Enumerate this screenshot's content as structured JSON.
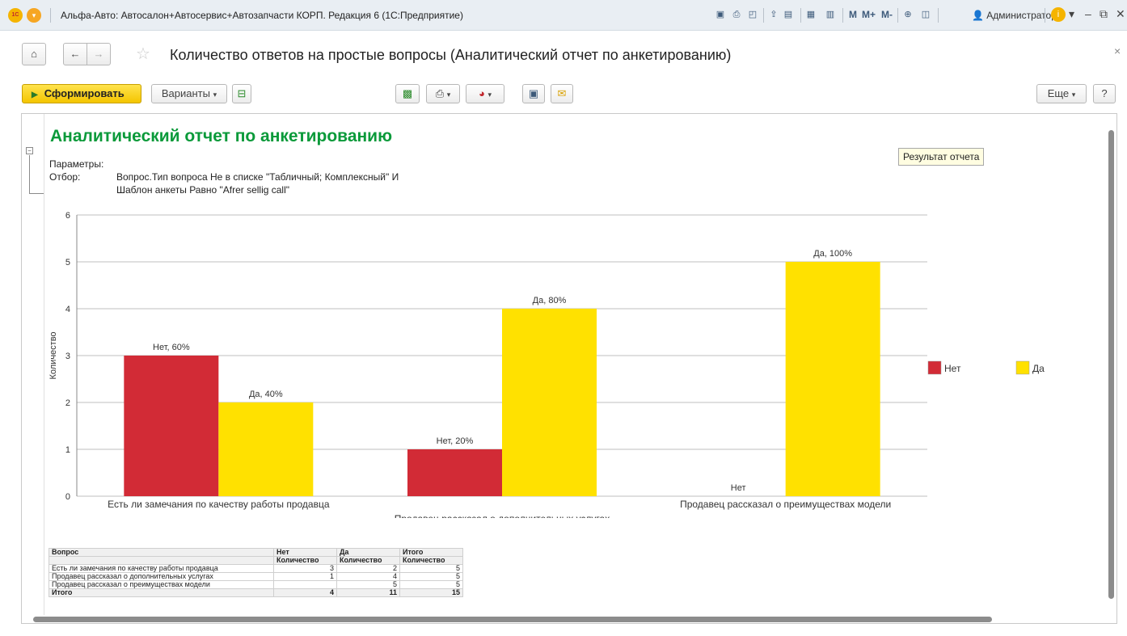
{
  "window": {
    "title": "Альфа-Авто: Автосалон+Автосервис+Автозапчасти КОРП. Редакция 6  (1С:Предприятие)",
    "logo_text": "1С",
    "user": "Администратор",
    "m_buttons": [
      "M",
      "M+",
      "M-"
    ]
  },
  "nav": {
    "page_title": "Количество ответов на простые вопросы (Аналитический отчет по анкетированию)"
  },
  "toolbar": {
    "generate_label": "Сформировать",
    "variants_label": "Варианты",
    "more_label": "Еще",
    "help_label": "?"
  },
  "report": {
    "title": "Аналитический отчет по анкетированию",
    "params_label": "Параметры:",
    "filter_label": "Отбор:",
    "filter_lines": [
      "Вопрос.Тип вопроса Не в списке \"Табличный; Комплексный\" И",
      "Шаблон анкеты Равно \"Afrer sellig call\""
    ],
    "tooltip": "Результат отчета"
  },
  "chart_data": {
    "type": "bar",
    "categories": [
      "Есть ли замечания по качеству работы продавца",
      "Продавец рассказал о дополнительных услугах",
      "Продавец рассказал о преимуществах модели"
    ],
    "series": [
      {
        "name": "Нет",
        "color": "#d22b36",
        "values": [
          3,
          1,
          0
        ],
        "labels": [
          "Нет, 60%",
          "Нет, 20%",
          "Нет"
        ]
      },
      {
        "name": "Да",
        "color": "#ffe100",
        "values": [
          2,
          4,
          5
        ],
        "labels": [
          "Да, 40%",
          "Да, 80%",
          "Да, 100%"
        ]
      }
    ],
    "ylabel": "Количество",
    "xlabel": "",
    "ylim": [
      0,
      6
    ],
    "yticks": [
      "0",
      "1",
      "2",
      "3",
      "4",
      "5",
      "6"
    ],
    "grid": true,
    "legend": "right"
  },
  "table": {
    "header": [
      "Вопрос",
      "Нет",
      "Да",
      "Итого"
    ],
    "subheader": [
      "",
      "Количество",
      "Количество",
      "Количество"
    ],
    "rows": [
      [
        "Есть ли замечания по качеству работы продавца",
        "3",
        "2",
        "5"
      ],
      [
        "Продавец рассказал о дополнительных услугах",
        "1",
        "4",
        "5"
      ],
      [
        "Продавец рассказал о преимуществах модели",
        "",
        "5",
        "5"
      ]
    ],
    "total": [
      "Итого",
      "4",
      "11",
      "15"
    ]
  }
}
